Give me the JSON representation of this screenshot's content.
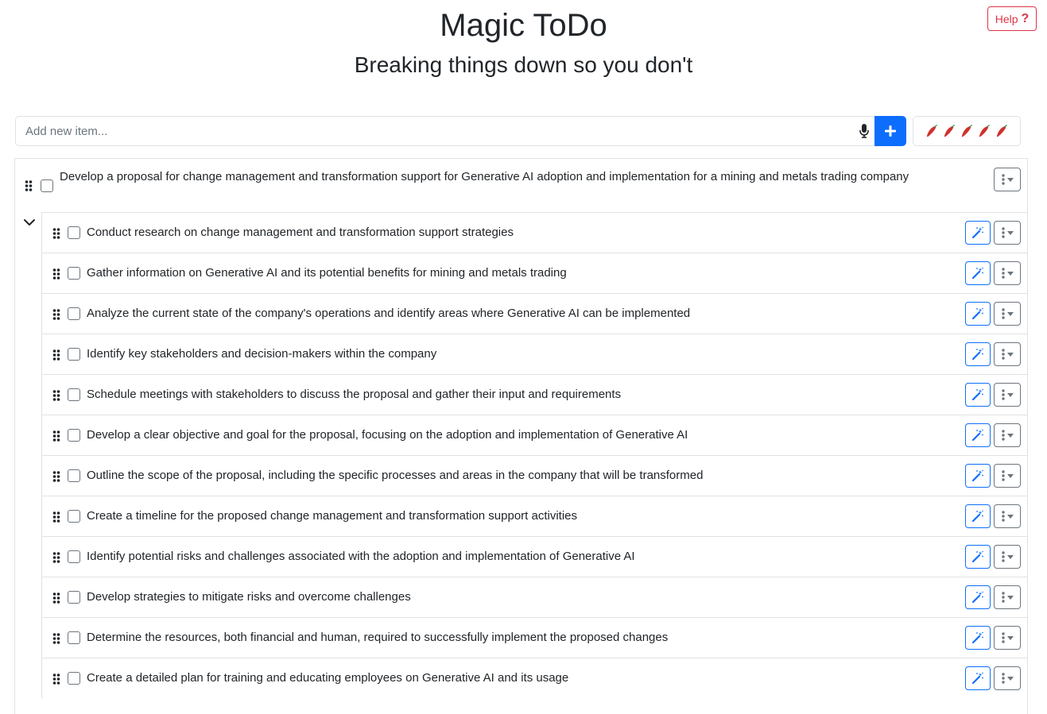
{
  "header": {
    "title": "Magic ToDo",
    "subtitle": "Breaking things down so you don't",
    "help_label": "Help",
    "help_icon": "question-mark-icon"
  },
  "add_item": {
    "placeholder": "Add new item...",
    "mic_icon": "microphone-icon",
    "add_icon": "plus-icon"
  },
  "spiciness": {
    "icon": "chili-pepper-icon",
    "level": 5,
    "max": 5
  },
  "colors": {
    "primary": "#0d6efd",
    "danger": "#dc3545",
    "border": "#dee2e6",
    "secondary": "#6c757d",
    "pepper_red": "#d0312d",
    "pepper_green": "#2e8b3a"
  },
  "parent_task": {
    "text": "Develop a proposal for change management and transformation support for Generative AI adoption and implementation for a mining and metals trading company",
    "expanded": true
  },
  "subtasks": [
    {
      "text": "Conduct research on change management and transformation support strategies"
    },
    {
      "text": "Gather information on Generative AI and its potential benefits for mining and metals trading"
    },
    {
      "text": "Analyze the current state of the company's operations and identify areas where Generative AI can be implemented"
    },
    {
      "text": "Identify key stakeholders and decision-makers within the company"
    },
    {
      "text": "Schedule meetings with stakeholders to discuss the proposal and gather their input and requirements"
    },
    {
      "text": "Develop a clear objective and goal for the proposal, focusing on the adoption and implementation of Generative AI"
    },
    {
      "text": "Outline the scope of the proposal, including the specific processes and areas in the company that will be transformed"
    },
    {
      "text": "Create a timeline for the proposed change management and transformation support activities"
    },
    {
      "text": "Identify potential risks and challenges associated with the adoption and implementation of Generative AI"
    },
    {
      "text": "Develop strategies to mitigate risks and overcome challenges"
    },
    {
      "text": "Determine the resources, both financial and human, required to successfully implement the proposed changes"
    },
    {
      "text": "Create a detailed plan for training and educating employees on Generative AI and its usage"
    }
  ]
}
